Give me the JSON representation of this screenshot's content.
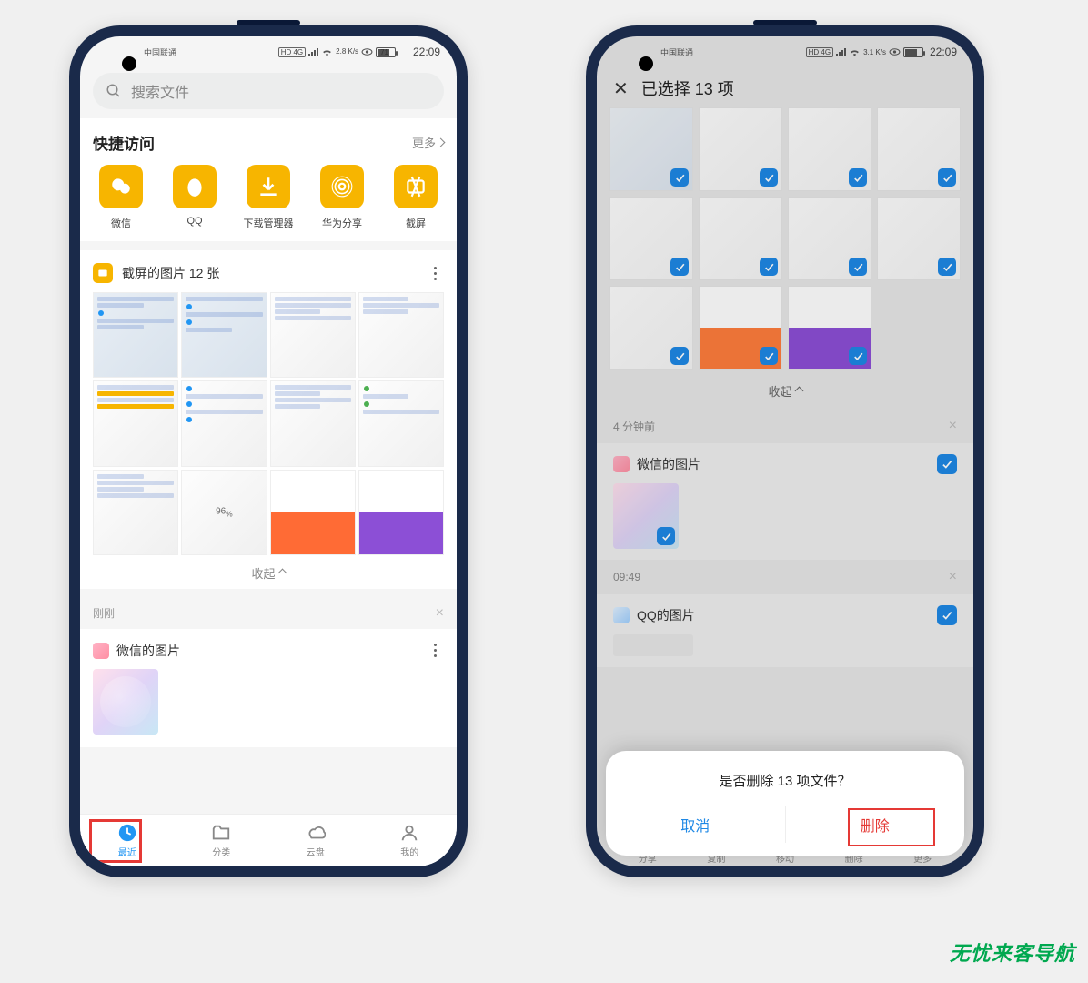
{
  "left": {
    "status": {
      "carrier": "中国联通",
      "net": "HD 4G",
      "speed": "2.8 K/s",
      "battery": "71",
      "time": "22:09"
    },
    "search_placeholder": "搜索文件",
    "quick_access": {
      "title": "快捷访问",
      "more": "更多",
      "items": [
        {
          "label": "微信"
        },
        {
          "label": "QQ"
        },
        {
          "label": "下载管理器"
        },
        {
          "label": "华为分享"
        },
        {
          "label": "截屏"
        }
      ]
    },
    "group1": {
      "title": "截屏的图片 12 张",
      "collapse": "收起"
    },
    "time_row": "刚刚",
    "group2": {
      "title": "微信的图片"
    },
    "tabs": [
      {
        "label": "最近"
      },
      {
        "label": "分类"
      },
      {
        "label": "云盘"
      },
      {
        "label": "我的"
      }
    ]
  },
  "right": {
    "status": {
      "carrier": "中国联通",
      "net": "HD 4G",
      "speed": "3.1 K/s",
      "battery": "",
      "time": "22:09"
    },
    "header": "已选择 13 项",
    "collapse": "收起",
    "time1": "4 分钟前",
    "sec_wx": "微信的图片",
    "time2": "09:49",
    "sec_qq": "QQ的图片",
    "sheet": {
      "title": "是否删除 13 项文件？",
      "cancel": "取消",
      "delete": "删除"
    },
    "bottom_hints": [
      "分享",
      "复制",
      "移动",
      "删除",
      "更多"
    ]
  },
  "watermark": "无忧来客导航"
}
